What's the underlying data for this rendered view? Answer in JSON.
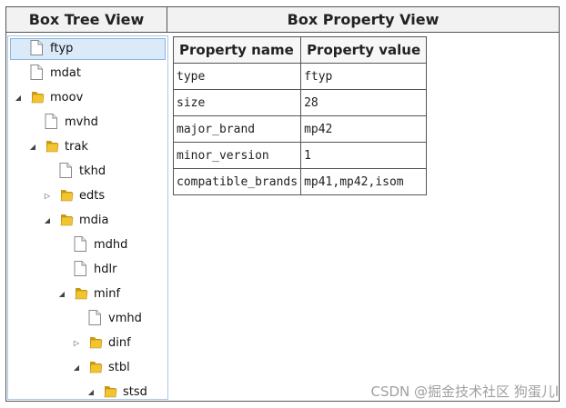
{
  "headers": {
    "tree": "Box Tree View",
    "property": "Box Property View"
  },
  "tree": {
    "items": [
      {
        "label": "ftyp",
        "kind": "file",
        "depth": 0,
        "toggle": "none",
        "selected": true
      },
      {
        "label": "mdat",
        "kind": "file",
        "depth": 0,
        "toggle": "none"
      },
      {
        "label": "moov",
        "kind": "folder",
        "depth": 0,
        "toggle": "expanded"
      },
      {
        "label": "mvhd",
        "kind": "file",
        "depth": 1,
        "toggle": "none"
      },
      {
        "label": "trak",
        "kind": "folder",
        "depth": 1,
        "toggle": "expanded"
      },
      {
        "label": "tkhd",
        "kind": "file",
        "depth": 2,
        "toggle": "none"
      },
      {
        "label": "edts",
        "kind": "folder",
        "depth": 2,
        "toggle": "collapsed"
      },
      {
        "label": "mdia",
        "kind": "folder",
        "depth": 2,
        "toggle": "expanded"
      },
      {
        "label": "mdhd",
        "kind": "file",
        "depth": 3,
        "toggle": "none"
      },
      {
        "label": "hdlr",
        "kind": "file",
        "depth": 3,
        "toggle": "none"
      },
      {
        "label": "minf",
        "kind": "folder",
        "depth": 3,
        "toggle": "expanded"
      },
      {
        "label": "vmhd",
        "kind": "file",
        "depth": 4,
        "toggle": "none"
      },
      {
        "label": "dinf",
        "kind": "folder",
        "depth": 4,
        "toggle": "collapsed"
      },
      {
        "label": "stbl",
        "kind": "folder",
        "depth": 4,
        "toggle": "expanded"
      },
      {
        "label": "stsd",
        "kind": "folder",
        "depth": 5,
        "toggle": "expanded"
      }
    ]
  },
  "properties": {
    "columns": [
      "Property name",
      "Property value"
    ],
    "rows": [
      {
        "name": "type",
        "value": "ftyp"
      },
      {
        "name": "size",
        "value": "28"
      },
      {
        "name": "major_brand",
        "value": "mp42"
      },
      {
        "name": "minor_version",
        "value": "1"
      },
      {
        "name": "compatible_brands",
        "value": "mp41,mp42,isom"
      }
    ]
  },
  "watermark": "CSDN @掘金技术社区 狗蛋儿l",
  "colors": {
    "selection": "#dbeaf8",
    "folder": "#e8b923",
    "panel_border": "#a9c7e6"
  }
}
